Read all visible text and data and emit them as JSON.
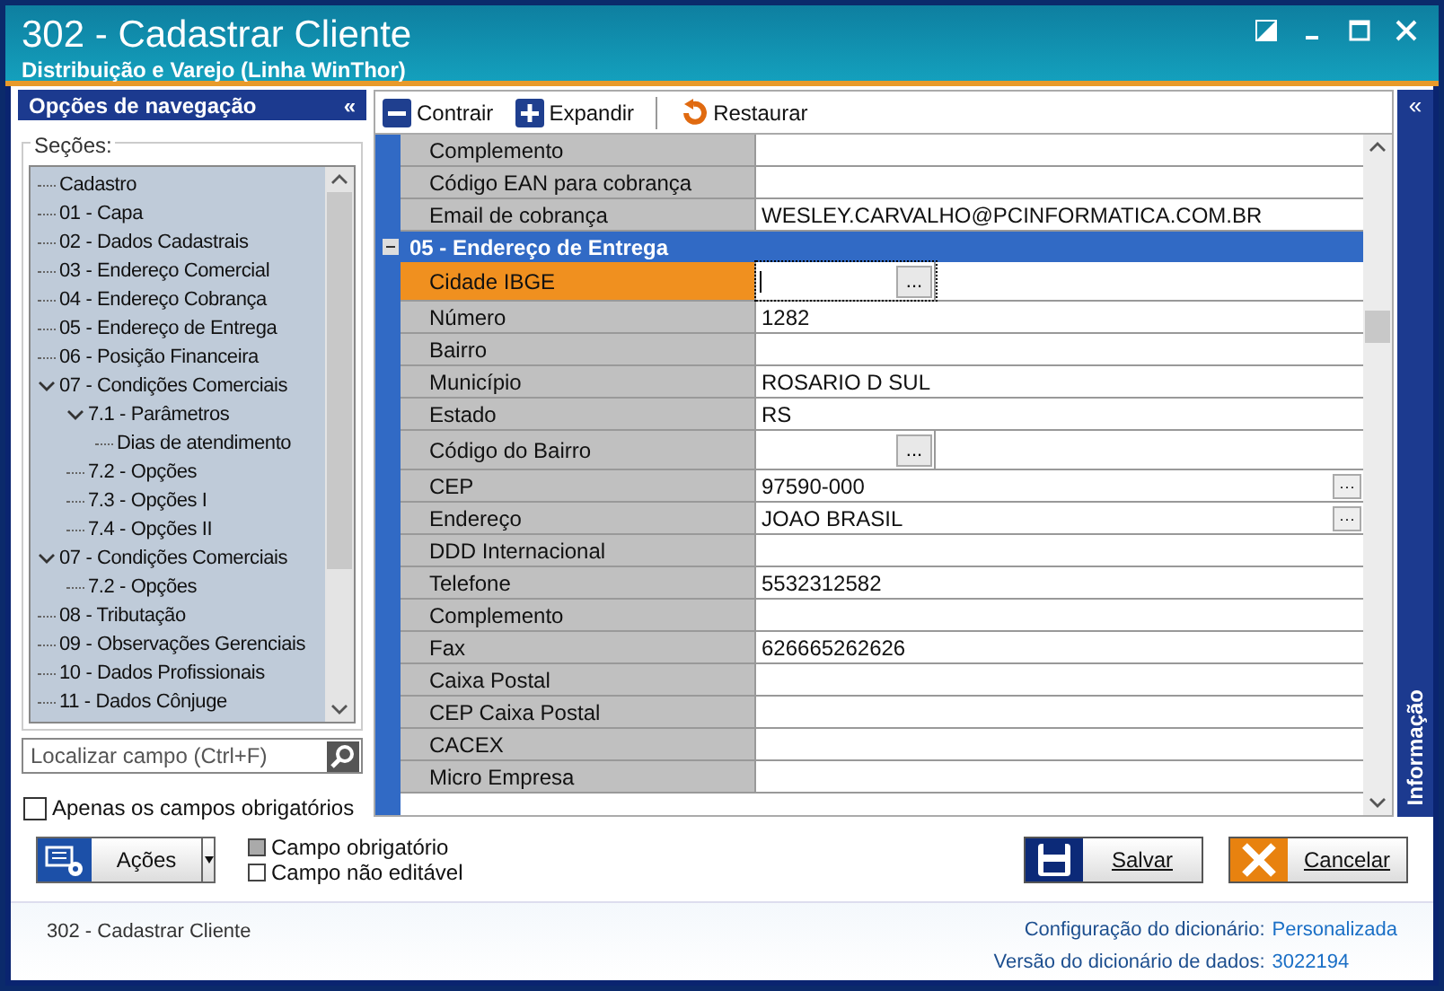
{
  "window": {
    "title": "302 - Cadastrar Cliente",
    "subtitle": "Distribuição e Varejo (Linha WinThor)"
  },
  "nav": {
    "title": "Opções de navegação",
    "collapse": "«",
    "sections_label": "Seções:",
    "tree": [
      {
        "label": "Cadastro"
      },
      {
        "label": "01 - Capa"
      },
      {
        "label": "02 - Dados Cadastrais"
      },
      {
        "label": "03 - Endereço Comercial"
      },
      {
        "label": "04 - Endereço Cobrança"
      },
      {
        "label": "05 - Endereço de Entrega"
      },
      {
        "label": "06 - Posição Financeira"
      },
      {
        "label": "07 - Condições Comerciais",
        "expanded": true,
        "children": [
          {
            "label": "7.1 - Parâmetros",
            "expanded": true,
            "children": [
              {
                "label": "Dias de atendimento"
              }
            ]
          },
          {
            "label": "7.2 - Opções"
          },
          {
            "label": "7.3 - Opções I"
          },
          {
            "label": "7.4 - Opções II"
          }
        ]
      },
      {
        "label": "07 - Condições Comerciais",
        "expanded": true,
        "children": [
          {
            "label": "7.2 - Opções"
          }
        ]
      },
      {
        "label": "08 - Tributação"
      },
      {
        "label": "09 - Observações Gerenciais"
      },
      {
        "label": "10 - Dados Profissionais"
      },
      {
        "label": "11 - Dados Cônjuge"
      }
    ],
    "search": {
      "placeholder": "Localizar campo (Ctrl+F)"
    },
    "required_only": {
      "label": "Apenas os campos obrigatórios",
      "checked": false
    }
  },
  "toolbar": [
    {
      "kind": "collapse",
      "label": "Contrair"
    },
    {
      "kind": "expand",
      "label": "Expandir"
    },
    {
      "kind": "restore",
      "label": "Restaurar"
    }
  ],
  "grid": [
    {
      "kind": "text",
      "label": "Complemento",
      "selected": false
    },
    {
      "kind": "text",
      "label": "Código EAN para cobrança",
      "selected": false
    },
    {
      "kind": "text",
      "label": "Email de cobrança",
      "value": "WESLEY.CARVALHO@PCINFORMATICA.COM.BR",
      "selected": false
    },
    {
      "kind": "section",
      "label": "05 - Endereço de Entrega",
      "expanded": true
    },
    {
      "kind": "lookup",
      "label": "Cidade IBGE",
      "button": "...",
      "selected": true
    },
    {
      "kind": "text",
      "label": "Número",
      "value": "1282",
      "selected": false
    },
    {
      "kind": "text",
      "label": "Bairro",
      "selected": false
    },
    {
      "kind": "text",
      "label": "Município",
      "value": "ROSARIO D SUL",
      "selected": false
    },
    {
      "kind": "text",
      "label": "Estado",
      "value": "RS",
      "selected": false
    },
    {
      "kind": "lookup",
      "label": "Código do Bairro",
      "button": "...",
      "selected": false
    },
    {
      "kind": "search",
      "label": "CEP",
      "value": "97590-000",
      "button": "···",
      "selected": false
    },
    {
      "kind": "search",
      "label": "Endereço",
      "value": "JOAO BRASIL",
      "button": "···",
      "selected": false
    },
    {
      "kind": "text",
      "label": "DDD Internacional",
      "selected": false
    },
    {
      "kind": "text",
      "label": "Telefone",
      "value": "5532312582",
      "selected": false
    },
    {
      "kind": "text",
      "label": "Complemento",
      "selected": false
    },
    {
      "kind": "text",
      "label": "Fax",
      "value": "626665262626",
      "selected": false
    },
    {
      "kind": "text",
      "label": "Caixa Postal",
      "selected": false
    },
    {
      "kind": "text",
      "label": "CEP Caixa Postal",
      "selected": false
    },
    {
      "kind": "text",
      "label": "CACEX",
      "selected": false
    },
    {
      "kind": "text",
      "label": "Micro Empresa",
      "selected": false
    }
  ],
  "info_panel": {
    "collapse": "«",
    "title": "Informação"
  },
  "actions": {
    "label": "Ações"
  },
  "legend": [
    {
      "kind": "required",
      "label": "Campo obrigatório"
    },
    {
      "kind": "readonly",
      "label": "Campo não editável"
    }
  ],
  "buttons": [
    {
      "kind": "save",
      "label": "Salvar"
    },
    {
      "kind": "cancel",
      "label": "Cancelar"
    }
  ],
  "status_bar": {
    "left": "302 - Cadastrar Cliente",
    "config_label": "Configuração do dicionário:",
    "config_value": "Personalizada",
    "version_label": "Versão do dicionário de dados:",
    "version_value": "3022194"
  }
}
